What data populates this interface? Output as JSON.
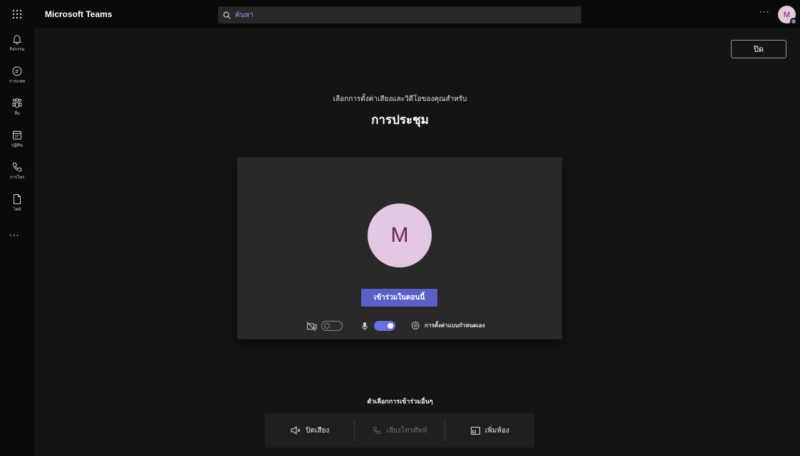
{
  "app": {
    "title": "Microsoft Teams"
  },
  "search": {
    "placeholder": "ค้นหา"
  },
  "header": {
    "more_label": "···",
    "avatar_initial": "M"
  },
  "rail": {
    "items": [
      {
        "label": "กิจกรรม",
        "icon": "bell-icon"
      },
      {
        "label": "การแชท",
        "icon": "chat-icon"
      },
      {
        "label": "ทีม",
        "icon": "teams-icon"
      },
      {
        "label": "ปฏิทิน",
        "icon": "calendar-icon"
      },
      {
        "label": "การโทร",
        "icon": "phone-icon"
      },
      {
        "label": "ไฟล์",
        "icon": "file-icon"
      }
    ],
    "more_label": "···"
  },
  "prejoin": {
    "close_label": "ปิด",
    "subtitle": "เลือกการตั้งค่าเสียงและวิดีโอของคุณสำหรับ",
    "title": "การประชุม",
    "avatar_initial": "M",
    "join_label": "เข้าร่วมในตอนนี้",
    "camera_on": false,
    "mic_on": true,
    "device_settings_label": "การตั้งค่าแบบกำหนดเอง"
  },
  "other_options": {
    "title": "ตัวเลือกการเข้าร่วมอื่นๆ",
    "audio_off_label": "ปิดเสียง",
    "phone_audio_label": "เสียงโทรศัพท์",
    "add_room_label": "เพิ่มห้อง"
  },
  "colors": {
    "accent": "#5b5fc7",
    "toggle_on": "#6a6fe0",
    "avatar_bg": "#e4c7e2",
    "avatar_fg": "#6a2160"
  }
}
